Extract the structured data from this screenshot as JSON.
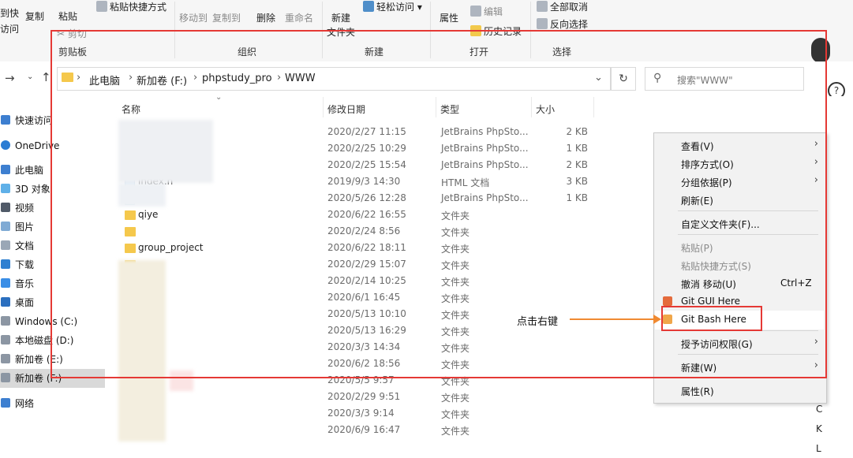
{
  "ribbon": {
    "clipboard": {
      "pin_label_1": "到快",
      "pin_label_2": "访问",
      "copy": "复制",
      "paste": "粘贴",
      "paste_shortcut": "粘贴快捷方式",
      "cut": "剪切",
      "group": "剪贴板"
    },
    "organize": {
      "move_to": "移动到",
      "copy_to": "复制到",
      "delete": "删除",
      "rename": "重命名",
      "group": "组织"
    },
    "new": {
      "new_folder_1": "新建",
      "new_folder_2": "文件夹",
      "easy_access": "轻松访问",
      "group": "新建"
    },
    "open": {
      "properties": "属性",
      "edit": "编辑",
      "history": "历史记录",
      "group": "打开"
    },
    "select": {
      "select_all": "全部取消",
      "invert": "反向选择",
      "group": "选择"
    }
  },
  "address": {
    "crumbs": [
      "此电脑",
      "新加卷 (F:)",
      "phpstudy_pro",
      "WWW"
    ],
    "search_placeholder": "搜索\"WWW\""
  },
  "help": {
    "label": "帮助"
  },
  "sidebar": {
    "items": [
      {
        "label": "快速访问"
      },
      {
        "label": "OneDrive"
      },
      {
        "label": "此电脑"
      },
      {
        "label": "3D 对象"
      },
      {
        "label": "视频"
      },
      {
        "label": "图片"
      },
      {
        "label": "文档"
      },
      {
        "label": "下载"
      },
      {
        "label": "音乐"
      },
      {
        "label": "桌面"
      },
      {
        "label": "Windows (C:)"
      },
      {
        "label": "本地磁盘 (D:)"
      },
      {
        "label": "新加卷 (E:)"
      },
      {
        "label": "新加卷 (F:)"
      },
      {
        "label": "网络"
      }
    ]
  },
  "columns": {
    "name": "名称",
    "date": "修改日期",
    "type": "类型",
    "size": "大小"
  },
  "files": [
    {
      "name": "",
      "date": "2020/2/27 11:15",
      "type": "JetBrains PhpSto...",
      "size": "2 KB",
      "kind": "file"
    },
    {
      "name": "hp",
      "date": "2020/2/25 10:29",
      "type": "JetBrains PhpSto...",
      "size": "1 KB",
      "kind": "file"
    },
    {
      "name": "",
      "date": "2020/2/25 15:54",
      "type": "JetBrains PhpSto...",
      "size": "2 KB",
      "kind": "file"
    },
    {
      "name": "index.h",
      "date": "2019/9/3 14:30",
      "type": "HTML 文档",
      "size": "3 KB",
      "kind": "file"
    },
    {
      "name": "",
      "date": "2020/5/26 12:28",
      "type": "JetBrains PhpSto...",
      "size": "1 KB",
      "kind": "file"
    },
    {
      "name": "qiye",
      "date": "2020/6/22 16:55",
      "type": "文件夹",
      "size": "",
      "kind": "folder"
    },
    {
      "name": "",
      "date": "2020/2/24 8:56",
      "type": "文件夹",
      "size": "",
      "kind": "folder"
    },
    {
      "name": "group_project",
      "date": "2020/6/22 18:11",
      "type": "文件夹",
      "size": "",
      "kind": "folder"
    },
    {
      "name": "",
      "date": "2020/2/29 15:07",
      "type": "文件夹",
      "size": "",
      "kind": "folder"
    },
    {
      "name": "",
      "date": "2020/2/14 10:25",
      "type": "文件夹",
      "size": "",
      "kind": "folder"
    },
    {
      "name": "",
      "date": "2020/6/1 16:45",
      "type": "文件夹",
      "size": "",
      "kind": "folder"
    },
    {
      "name": "",
      "date": "2020/5/13 10:10",
      "type": "文件夹",
      "size": "",
      "kind": "folder"
    },
    {
      "name": "",
      "date": "2020/5/13 16:29",
      "type": "文件夹",
      "size": "",
      "kind": "folder"
    },
    {
      "name": "",
      "date": "2020/3/3 14:34",
      "type": "文件夹",
      "size": "",
      "kind": "folder"
    },
    {
      "name": "",
      "date": "2020/6/2 18:56",
      "type": "文件夹",
      "size": "",
      "kind": "folder"
    },
    {
      "name": "",
      "date": "2020/5/5 9:57",
      "type": "文件夹",
      "size": "",
      "kind": "folder"
    },
    {
      "name": "",
      "date": "2020/2/29 9:51",
      "type": "文件夹",
      "size": "",
      "kind": "folder"
    },
    {
      "name": "",
      "date": "2020/3/3 9:14",
      "type": "文件夹",
      "size": "",
      "kind": "folder"
    },
    {
      "name": "",
      "date": "2020/6/9 16:47",
      "type": "文件夹",
      "size": "",
      "kind": "folder"
    }
  ],
  "context_menu": {
    "view": "查看(V)",
    "sort": "排序方式(O)",
    "group_by": "分组依据(P)",
    "refresh": "刷新(E)",
    "customize": "自定义文件夹(F)...",
    "paste": "粘贴(P)",
    "paste_shortcut": "粘贴快捷方式(S)",
    "undo": "撤消 移动(U)",
    "undo_shortcut": "Ctrl+Z",
    "git_gui": "Git GUI Here",
    "git_bash": "Git Bash Here",
    "grant_access": "授予访问权限(G)",
    "new": "新建(W)",
    "properties": "属性(R)"
  },
  "annotation": {
    "label": "点击右键"
  },
  "edge_letters": [
    "C",
    "K",
    "L"
  ]
}
